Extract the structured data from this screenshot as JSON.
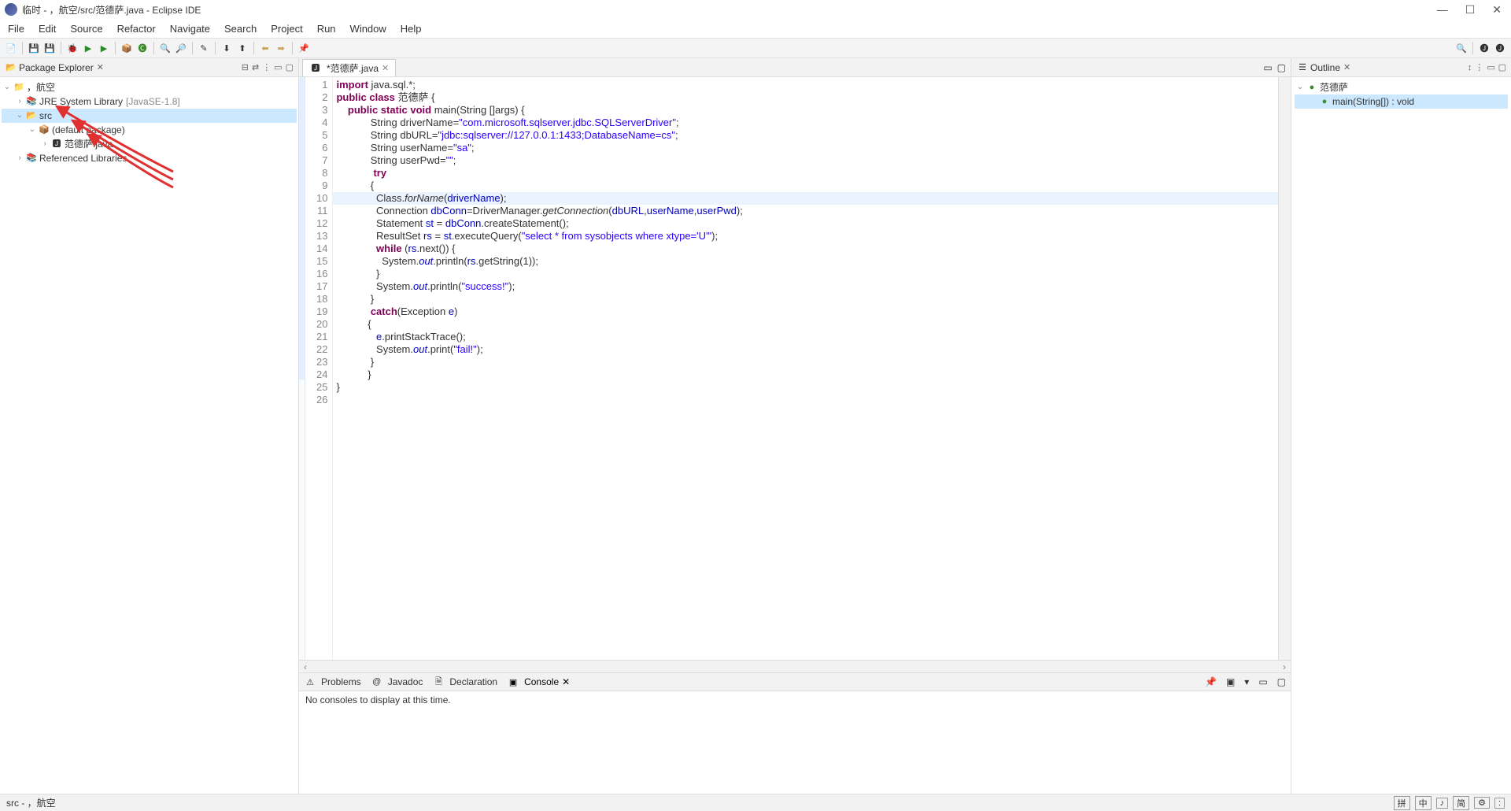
{
  "window": {
    "title": "临时 - ，航空/src/范德萨.java - Eclipse IDE",
    "min": "—",
    "max": "☐",
    "close": "✕"
  },
  "menu": [
    "File",
    "Edit",
    "Source",
    "Refactor",
    "Navigate",
    "Search",
    "Project",
    "Run",
    "Window",
    "Help"
  ],
  "packageExplorer": {
    "title": "Package Explorer",
    "items": {
      "project": "，航空",
      "jre": "JRE System Library",
      "jre_suffix": "[JavaSE-1.8]",
      "src": "src",
      "pkg": "(default package)",
      "file": "范德萨.java",
      "ref": "Referenced Libraries"
    }
  },
  "editor": {
    "tab": "*范德萨.java",
    "lines": [
      {
        "n": 1,
        "h": false,
        "seg": [
          {
            "t": "import",
            "c": "kw"
          },
          {
            "t": " java.sql.*;"
          }
        ]
      },
      {
        "n": 2,
        "h": false,
        "seg": [
          {
            "t": "public class",
            "c": "kw"
          },
          {
            "t": " 范德萨 {"
          }
        ]
      },
      {
        "n": 3,
        "h": false,
        "seg": [
          {
            "t": "    "
          },
          {
            "t": "public static void",
            "c": "kw"
          },
          {
            "t": " main(String []args) {"
          }
        ]
      },
      {
        "n": 4,
        "h": false,
        "seg": [
          {
            "t": "            String driverName="
          },
          {
            "t": "\"com.microsoft.sqlserver.jdbc.SQLServerDriver\"",
            "c": "str"
          },
          {
            "t": ";"
          }
        ]
      },
      {
        "n": 5,
        "h": false,
        "seg": [
          {
            "t": "            String dbURL="
          },
          {
            "t": "\"jdbc:sqlserver://127.0.0.1:1433;DatabaseName=cs\"",
            "c": "str"
          },
          {
            "t": ";"
          }
        ]
      },
      {
        "n": 6,
        "h": false,
        "seg": [
          {
            "t": "            String userName="
          },
          {
            "t": "\"sa\"",
            "c": "str"
          },
          {
            "t": ";"
          }
        ]
      },
      {
        "n": 7,
        "h": false,
        "seg": [
          {
            "t": "            String userPwd="
          },
          {
            "t": "\"\"",
            "c": "str"
          },
          {
            "t": ";"
          }
        ]
      },
      {
        "n": 8,
        "h": false,
        "seg": [
          {
            "t": "             "
          },
          {
            "t": "try",
            "c": "kw"
          }
        ]
      },
      {
        "n": 9,
        "h": false,
        "seg": [
          {
            "t": "            {"
          }
        ]
      },
      {
        "n": 10,
        "h": true,
        "seg": [
          {
            "t": "              Class."
          },
          {
            "t": "forName",
            "c": "mth"
          },
          {
            "t": "("
          },
          {
            "t": "driverName",
            "c": "fld"
          },
          {
            "t": ");"
          }
        ]
      },
      {
        "n": 11,
        "h": false,
        "seg": [
          {
            "t": "              Connection "
          },
          {
            "t": "dbConn",
            "c": "fld"
          },
          {
            "t": "=DriverManager."
          },
          {
            "t": "getConnection",
            "c": "mth"
          },
          {
            "t": "("
          },
          {
            "t": "dbURL",
            "c": "fld"
          },
          {
            "t": ","
          },
          {
            "t": "userName",
            "c": "fld"
          },
          {
            "t": ","
          },
          {
            "t": "userPwd",
            "c": "fld"
          },
          {
            "t": ");"
          }
        ]
      },
      {
        "n": 12,
        "h": false,
        "seg": [
          {
            "t": "              Statement "
          },
          {
            "t": "st",
            "c": "fld"
          },
          {
            "t": " = "
          },
          {
            "t": "dbConn",
            "c": "fld"
          },
          {
            "t": ".createStatement();"
          }
        ]
      },
      {
        "n": 13,
        "h": false,
        "seg": [
          {
            "t": "              ResultSet "
          },
          {
            "t": "rs",
            "c": "fld"
          },
          {
            "t": " = "
          },
          {
            "t": "st",
            "c": "fld"
          },
          {
            "t": ".executeQuery("
          },
          {
            "t": "\"select * from sysobjects where xtype='U'\"",
            "c": "str"
          },
          {
            "t": ");"
          }
        ]
      },
      {
        "n": 14,
        "h": false,
        "seg": [
          {
            "t": "              "
          },
          {
            "t": "while",
            "c": "kw"
          },
          {
            "t": " ("
          },
          {
            "t": "rs",
            "c": "fld"
          },
          {
            "t": ".next()) {"
          }
        ]
      },
      {
        "n": 15,
        "h": false,
        "seg": [
          {
            "t": "                System."
          },
          {
            "t": "out",
            "c": "stat"
          },
          {
            "t": ".println("
          },
          {
            "t": "rs",
            "c": "fld"
          },
          {
            "t": ".getString(1));"
          }
        ]
      },
      {
        "n": 16,
        "h": false,
        "seg": [
          {
            "t": "              }"
          }
        ]
      },
      {
        "n": 17,
        "h": false,
        "seg": [
          {
            "t": "              System."
          },
          {
            "t": "out",
            "c": "stat"
          },
          {
            "t": ".println("
          },
          {
            "t": "\"success!\"",
            "c": "str"
          },
          {
            "t": ");"
          }
        ]
      },
      {
        "n": 18,
        "h": false,
        "seg": [
          {
            "t": "            }"
          }
        ]
      },
      {
        "n": 19,
        "h": false,
        "seg": [
          {
            "t": "            "
          },
          {
            "t": "catch",
            "c": "kw"
          },
          {
            "t": "(Exception "
          },
          {
            "t": "e",
            "c": "fld"
          },
          {
            "t": ")"
          }
        ]
      },
      {
        "n": 20,
        "h": false,
        "seg": [
          {
            "t": "           {"
          }
        ]
      },
      {
        "n": 21,
        "h": false,
        "seg": [
          {
            "t": "              "
          },
          {
            "t": "e",
            "c": "fld"
          },
          {
            "t": ".printStackTrace();"
          }
        ]
      },
      {
        "n": 22,
        "h": false,
        "seg": [
          {
            "t": "              System."
          },
          {
            "t": "out",
            "c": "stat"
          },
          {
            "t": ".print("
          },
          {
            "t": "\"fail!\"",
            "c": "str"
          },
          {
            "t": ");"
          }
        ]
      },
      {
        "n": 23,
        "h": false,
        "seg": [
          {
            "t": "            }"
          }
        ]
      },
      {
        "n": 24,
        "h": false,
        "seg": [
          {
            "t": "           }"
          }
        ]
      },
      {
        "n": 25,
        "h": false,
        "seg": [
          {
            "t": "}"
          }
        ]
      },
      {
        "n": 26,
        "h": false,
        "seg": [
          {
            "t": ""
          }
        ]
      }
    ]
  },
  "bottomTabs": {
    "problems": "Problems",
    "javadoc": "Javadoc",
    "declaration": "Declaration",
    "console": "Console"
  },
  "console": {
    "msg": "No consoles to display at this time."
  },
  "outline": {
    "title": "Outline",
    "class": "范德萨",
    "method": "main(String[]) : void"
  },
  "status": {
    "left": "src - ，航空",
    "ime": [
      "拼",
      "中",
      "♪",
      "简",
      "⚙",
      ":"
    ]
  }
}
